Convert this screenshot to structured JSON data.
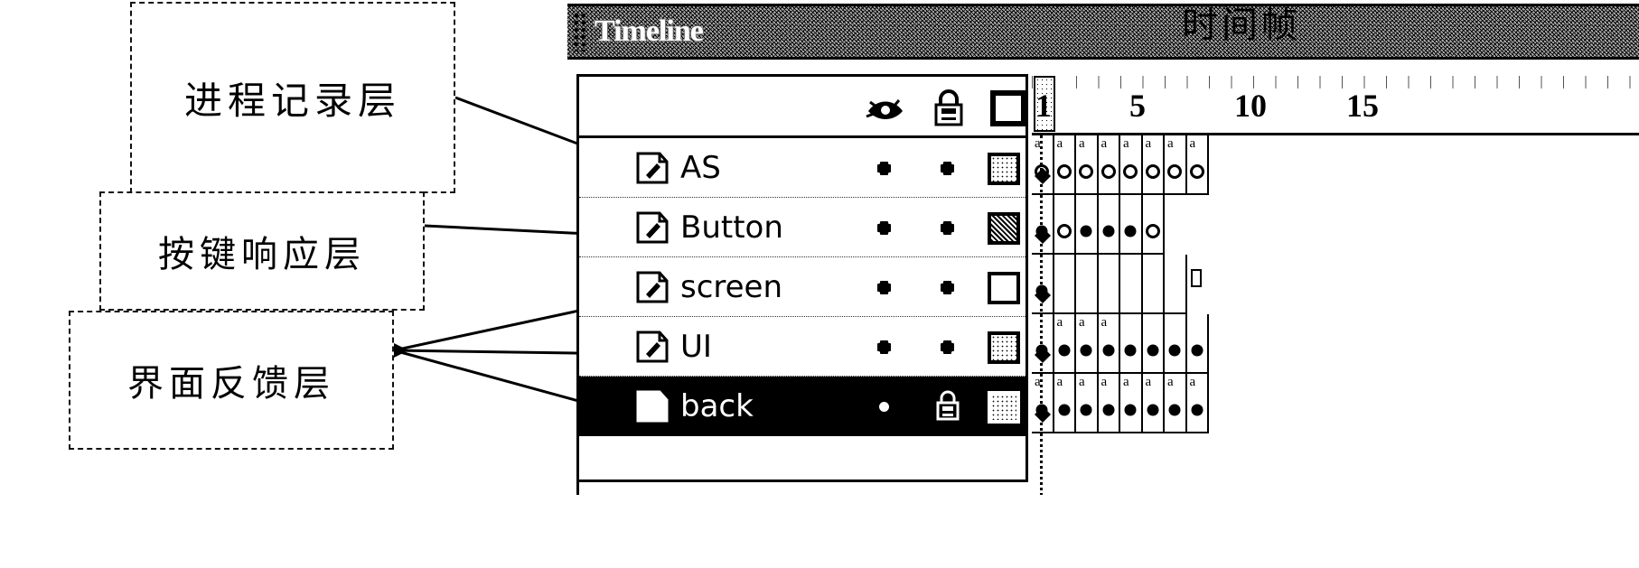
{
  "annotations": [
    {
      "id": "process-log-layer",
      "text": "进程记录层"
    },
    {
      "id": "key-response-layer",
      "text": "按键响应层"
    },
    {
      "id": "ui-feedback-layer",
      "text": "界面反馈层"
    }
  ],
  "panel": {
    "title": "Timeline",
    "chinese_overlay": "时间帧",
    "columns": {
      "eye": "eye-icon",
      "lock": "lock-icon",
      "outline": "outline-square-icon"
    }
  },
  "ruler": {
    "current_frame": "1",
    "labels": [
      "1",
      "5",
      "10",
      "15"
    ]
  },
  "layers": [
    {
      "name": "AS",
      "visible_dot": "•",
      "lock_dot": "•",
      "outline": "light",
      "selected": false
    },
    {
      "name": "Button",
      "visible_dot": "•",
      "lock_dot": "•",
      "outline": "dark",
      "selected": false
    },
    {
      "name": "screen",
      "visible_dot": "•",
      "lock_dot": "•",
      "outline": "none",
      "selected": false
    },
    {
      "name": "UI",
      "visible_dot": "•",
      "lock_dot": "•",
      "outline": "light",
      "selected": false
    },
    {
      "name": "back",
      "visible_dot": "•",
      "lock_dot": "lock-icon",
      "outline": "light",
      "selected": true
    }
  ],
  "frames": {
    "script_marker": "a",
    "rows": [
      {
        "layer": "AS",
        "cells": [
          {
            "type": "key",
            "mark": "a",
            "fill": "hollow"
          },
          {
            "type": "key",
            "mark": "a",
            "fill": "hollow"
          },
          {
            "type": "key",
            "mark": "a",
            "fill": "hollow"
          },
          {
            "type": "key",
            "mark": "a",
            "fill": "hollow"
          },
          {
            "type": "key",
            "mark": "a",
            "fill": "hollow"
          },
          {
            "type": "key",
            "mark": "a",
            "fill": "hollow"
          },
          {
            "type": "key",
            "mark": "a",
            "fill": "hollow"
          },
          {
            "type": "key",
            "mark": "a",
            "fill": "hollow"
          }
        ]
      },
      {
        "layer": "Button",
        "cells": [
          {
            "type": "key",
            "mark": "",
            "fill": "solid"
          },
          {
            "type": "key",
            "mark": "",
            "fill": "hollow"
          },
          {
            "type": "key",
            "mark": "",
            "fill": "solid"
          },
          {
            "type": "key",
            "mark": "",
            "fill": "solid"
          },
          {
            "type": "key",
            "mark": "",
            "fill": "solid"
          },
          {
            "type": "key",
            "mark": "",
            "fill": "hollow"
          }
        ]
      },
      {
        "layer": "screen",
        "cells": [
          {
            "type": "key",
            "mark": "",
            "fill": "solid"
          },
          {
            "type": "span",
            "mark": "",
            "fill": "none"
          },
          {
            "type": "span",
            "mark": "",
            "fill": "none"
          },
          {
            "type": "span",
            "mark": "",
            "fill": "none"
          },
          {
            "type": "span",
            "mark": "",
            "fill": "none"
          },
          {
            "type": "span",
            "mark": "",
            "fill": "none"
          },
          {
            "type": "span",
            "mark": "",
            "fill": "none"
          },
          {
            "type": "blank",
            "mark": "",
            "fill": "none"
          }
        ]
      },
      {
        "layer": "UI",
        "cells": [
          {
            "type": "key",
            "mark": "",
            "fill": "solid"
          },
          {
            "type": "key",
            "mark": "a",
            "fill": "solid"
          },
          {
            "type": "key",
            "mark": "a",
            "fill": "solid"
          },
          {
            "type": "key",
            "mark": "a",
            "fill": "solid"
          },
          {
            "type": "key",
            "mark": "",
            "fill": "solid"
          },
          {
            "type": "key",
            "mark": "",
            "fill": "solid"
          },
          {
            "type": "key",
            "mark": "",
            "fill": "solid"
          },
          {
            "type": "key",
            "mark": "",
            "fill": "solid"
          }
        ]
      },
      {
        "layer": "back",
        "cells": [
          {
            "type": "key",
            "mark": "a",
            "fill": "solid"
          },
          {
            "type": "key",
            "mark": "a",
            "fill": "solid"
          },
          {
            "type": "key",
            "mark": "a",
            "fill": "solid"
          },
          {
            "type": "key",
            "mark": "a",
            "fill": "solid"
          },
          {
            "type": "key",
            "mark": "a",
            "fill": "solid"
          },
          {
            "type": "key",
            "mark": "a",
            "fill": "solid"
          },
          {
            "type": "key",
            "mark": "a",
            "fill": "solid"
          },
          {
            "type": "key",
            "mark": "a",
            "fill": "solid"
          }
        ]
      }
    ]
  }
}
